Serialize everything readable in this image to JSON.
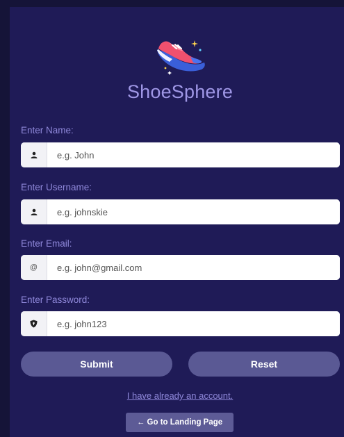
{
  "app": {
    "brand_name": "ShoeSphere",
    "logo_icon": "sneaker-icon"
  },
  "form": {
    "fields": [
      {
        "label": "Enter Name:",
        "placeholder": "e.g. John",
        "icon": "user-icon"
      },
      {
        "label": "Enter Username:",
        "placeholder": "e.g. johnskie",
        "icon": "user-icon"
      },
      {
        "label": "Enter Email:",
        "placeholder": "e.g. john@gmail.com",
        "icon": "at-icon",
        "icon_glyph": "@"
      },
      {
        "label": "Enter Password:",
        "placeholder": "e.g. john123",
        "icon": "shield-icon"
      }
    ],
    "submit_label": "Submit",
    "reset_label": "Reset",
    "login_link": "I have already an account.",
    "landing_button": "← Go to Landing Page"
  },
  "colors": {
    "background": "#151438",
    "panel": "#1f1b57",
    "label": "#8f88da",
    "brand": "#9f97e6",
    "button": "#5a5994"
  }
}
